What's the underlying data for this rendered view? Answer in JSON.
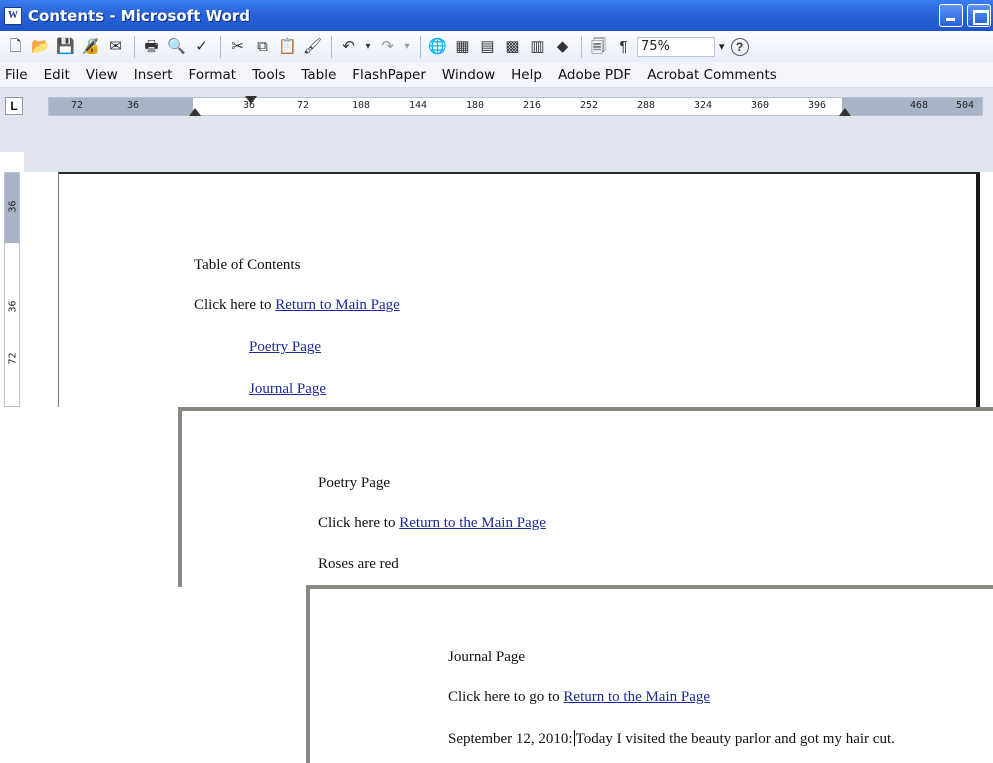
{
  "window": {
    "title": "Contents - Microsoft Word",
    "icon": "W"
  },
  "toolbar": {
    "zoom": "75%",
    "show_hide_symbol": "¶",
    "help_symbol": "?"
  },
  "menu": {
    "items": [
      "File",
      "Edit",
      "View",
      "Insert",
      "Format",
      "Tools",
      "Table",
      "FlashPaper",
      "Window",
      "Help",
      "Adobe PDF",
      "Acrobat Comments"
    ]
  },
  "ruler": {
    "tab_selector": "L",
    "ticks": [
      "72",
      "36",
      "36",
      "72",
      "108",
      "144",
      "180",
      "216",
      "252",
      "288",
      "324",
      "360",
      "396",
      "468",
      "504"
    ],
    "vertical_ticks": [
      "36",
      "36",
      "72"
    ]
  },
  "documents": [
    {
      "heading": "Table of Contents",
      "line1_prefix": "Click here to ",
      "line1_link": "Return to Main Page",
      "links": [
        "Poetry Page",
        "Journal Page"
      ]
    },
    {
      "heading": "Poetry Page",
      "line1_prefix": "Click here to ",
      "line1_link": "Return to the Main Page",
      "body": "Roses are red"
    },
    {
      "heading": "Journal Page",
      "line1_prefix": "Click here to go to ",
      "line1_link": "Return to the Main Page",
      "entry_date": "September 12, 2010:",
      "entry_text": "Today I visited the beauty parlor and got my hair cut."
    }
  ],
  "colors": {
    "titlebar": "#2a62d8",
    "link": "#1a2a9a"
  }
}
